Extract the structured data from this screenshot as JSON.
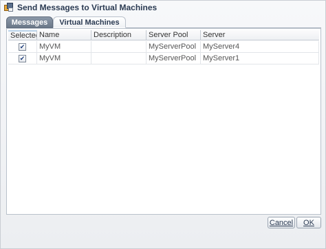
{
  "window": {
    "title": "Send Messages to Virtual Machines",
    "icon": "vm-messages-icon"
  },
  "tabs": [
    {
      "label": "Messages",
      "selected": false
    },
    {
      "label": "Virtual Machines",
      "selected": true
    }
  ],
  "table": {
    "columns": [
      "Selected",
      "Name",
      "Description",
      "Server Pool",
      "Server"
    ],
    "rows": [
      {
        "selected": true,
        "name": "MyVM",
        "description": "",
        "server_pool": "MyServerPool",
        "server": "MyServer4"
      },
      {
        "selected": true,
        "name": "MyVM",
        "description": "",
        "server_pool": "MyServerPool",
        "server": "MyServer1"
      }
    ]
  },
  "buttons": {
    "cancel_label": "Cancel",
    "ok_label": "OK"
  }
}
